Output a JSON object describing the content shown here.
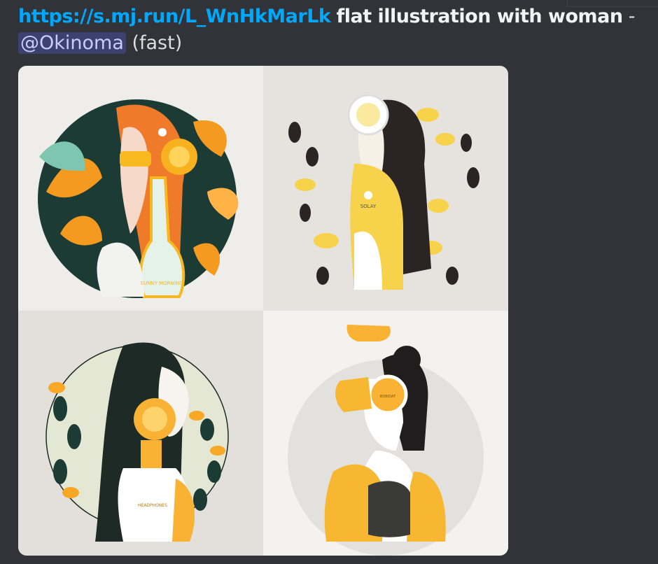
{
  "message": {
    "link_text": "https://s.mj.run/L_WnHkMarLk",
    "prompt_text": "flat illustration with woman",
    "separator": "-",
    "mention": "@Okinoma",
    "speed": "(fast)"
  },
  "images": [
    {
      "bottle_text": "SUNNY MORNING",
      "accent": "#f9a11b"
    },
    {
      "bottle_text": "SOLAY",
      "accent": "#f6d34a"
    },
    {
      "bottle_text": "HEADPHONES",
      "accent": "#f9b233"
    },
    {
      "bottle_text": "BOBIDAT",
      "accent": "#f7b731"
    }
  ],
  "colors": {
    "background": "#313338",
    "link": "#00a8fc",
    "mention_bg": "#3c4270",
    "mention_text": "#c9cdfb"
  }
}
